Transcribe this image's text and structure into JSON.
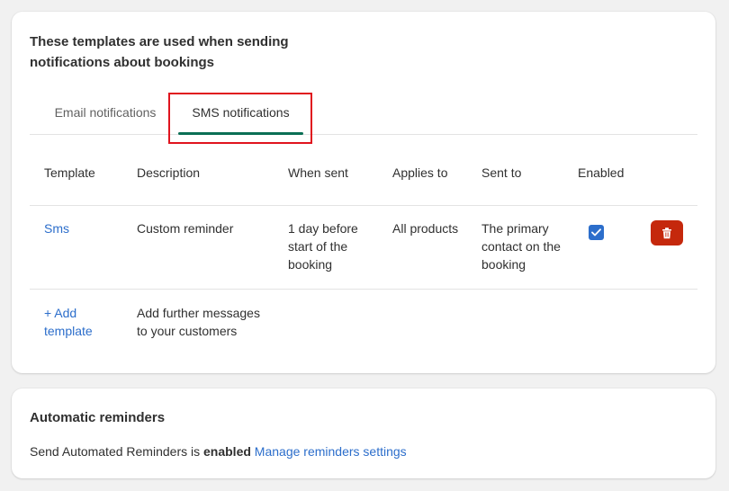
{
  "templates_card": {
    "heading": "These templates are used when sending notifications about bookings",
    "tabs": [
      {
        "label": "Email notifications",
        "selected": false
      },
      {
        "label": "SMS notifications",
        "selected": true
      }
    ],
    "columns": [
      "Template",
      "Description",
      "When sent",
      "Applies to",
      "Sent to",
      "Enabled"
    ],
    "rows": [
      {
        "template": "Sms",
        "description": "Custom reminder",
        "when_sent": "1 day before start of the booking",
        "applies_to": "All products",
        "sent_to": "The primary contact on the booking",
        "enabled": true
      }
    ],
    "add_template": {
      "label": "+ Add template",
      "description": "Add further messages to your customers"
    }
  },
  "reminders_card": {
    "title": "Automatic reminders",
    "text_prefix": "Send Automated Reminders is",
    "status": "enabled",
    "link": "Manage reminders settings"
  },
  "colors": {
    "accent": "#2c6ecb",
    "tab_underline": "#0b6f55",
    "danger": "#c5280c",
    "highlight": "#e0141e"
  }
}
